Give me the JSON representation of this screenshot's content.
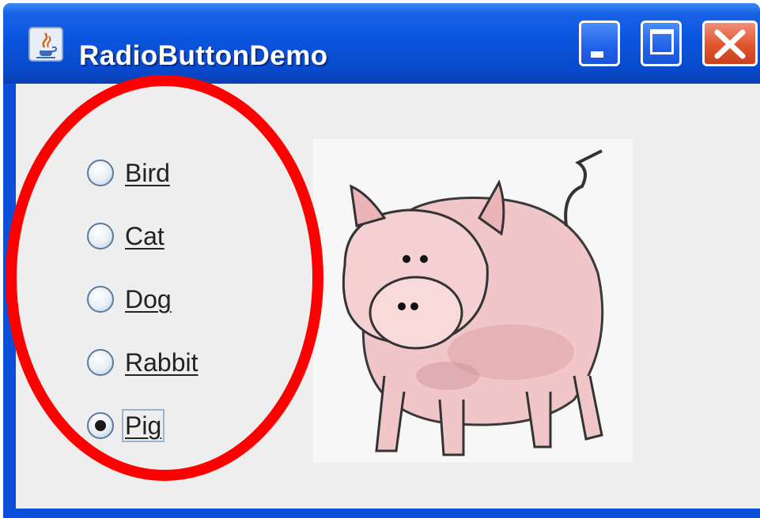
{
  "window": {
    "title": "RadioButtonDemo",
    "icons": {
      "app": "java-cup-icon",
      "minimize": "minimize-icon",
      "maximize": "maximize-icon",
      "close": "close-icon"
    }
  },
  "radios": [
    {
      "label": "Bird",
      "selected": false
    },
    {
      "label": "Cat",
      "selected": false
    },
    {
      "label": "Dog",
      "selected": false
    },
    {
      "label": "Rabbit",
      "selected": false
    },
    {
      "label": "Pig",
      "selected": true
    }
  ],
  "image": {
    "subject": "pig"
  },
  "colors": {
    "titlebar": "#0a55de",
    "content": "#eeeeee",
    "highlight_ellipse": "#ff0000",
    "close_button": "#e0542c"
  }
}
